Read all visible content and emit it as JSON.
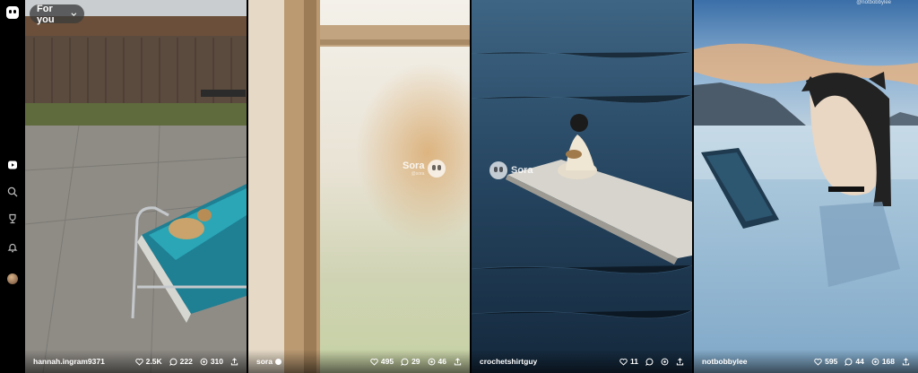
{
  "filter": {
    "label": "For you"
  },
  "rail": {
    "icons": [
      "app-logo",
      "home-icon",
      "search-icon",
      "trophy-icon",
      "bell-icon",
      "avatar"
    ]
  },
  "cards": [
    {
      "author": "hannah.ingram9371",
      "verified": false,
      "likes": "2.5K",
      "comments": "222",
      "remixes": "310"
    },
    {
      "author": "sora",
      "verified": true,
      "likes": "495",
      "comments": "29",
      "remixes": "46",
      "watermark": "Sora",
      "watermark_sub": "@sora"
    },
    {
      "author": "crochetshirtguy",
      "verified": false,
      "likes": "11",
      "comments": "",
      "remixes": "",
      "watermark": "Sora"
    },
    {
      "author": "notbobbylee",
      "verified": false,
      "likes": "595",
      "comments": "44",
      "remixes": "168",
      "top_handle": "@notbobbylee"
    }
  ]
}
